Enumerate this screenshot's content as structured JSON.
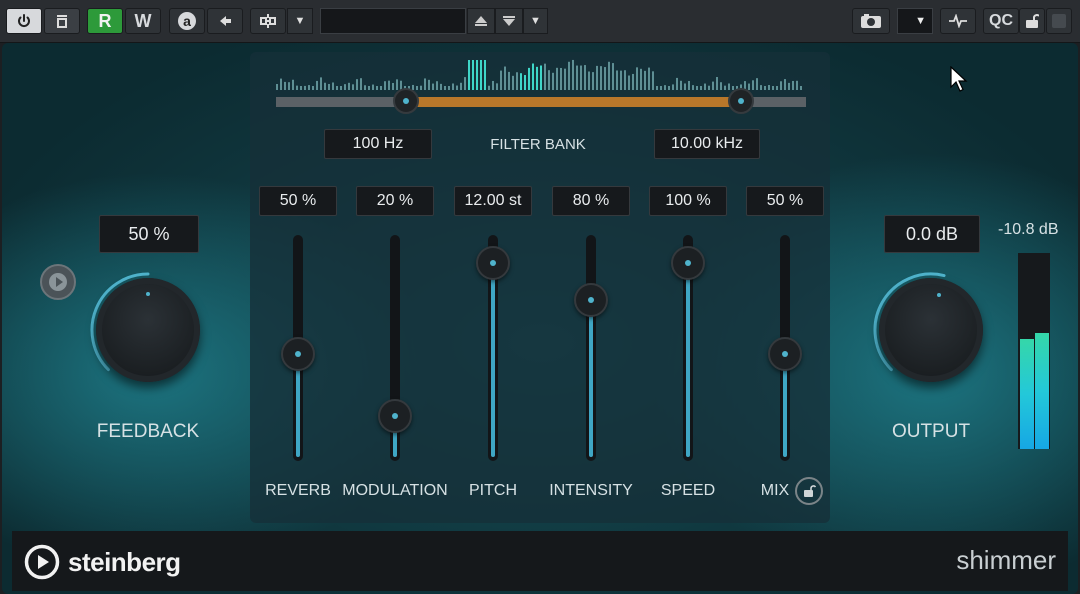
{
  "toolbar": {
    "power_icon": "power-icon",
    "bypass_icon": "bypass-icon",
    "read_label": "R",
    "write_label": "W",
    "auto_label": "a",
    "prev_icon": "arrow-left-icon",
    "sidechain_icon": "sidechain-icon",
    "preset_name": "",
    "qc_label": "QC",
    "accent_green": "#2d9a3a"
  },
  "plugin": {
    "filter_bank": {
      "label": "FILTER BANK",
      "low": "100 Hz",
      "high": "10.00 kHz",
      "range_fraction": [
        0.246,
        0.878
      ],
      "fill_color": "#b8772a"
    },
    "feedback": {
      "label": "FEEDBACK",
      "value": "50 %",
      "level": 0.5
    },
    "output": {
      "label": "OUTPUT",
      "value": "0.0 dB",
      "level": 0.5
    },
    "meter": {
      "readout": "-10.8 dB",
      "levels": [
        0.56,
        0.59
      ]
    },
    "sliders": [
      {
        "label": "REVERB",
        "value": "50 %",
        "level": 0.5
      },
      {
        "label": "MODULATION",
        "value": "20 %",
        "level": 0.2
      },
      {
        "label": "PITCH",
        "value": "12.00 st",
        "level": 0.94
      },
      {
        "label": "INTENSITY",
        "value": "80 %",
        "level": 0.76
      },
      {
        "label": "SPEED",
        "value": "100 %",
        "level": 0.94
      },
      {
        "label": "MIX",
        "value": "50 %",
        "level": 0.5
      }
    ],
    "brand": "steinberg",
    "product": "shimmer",
    "accent": "#4fb3cc"
  }
}
